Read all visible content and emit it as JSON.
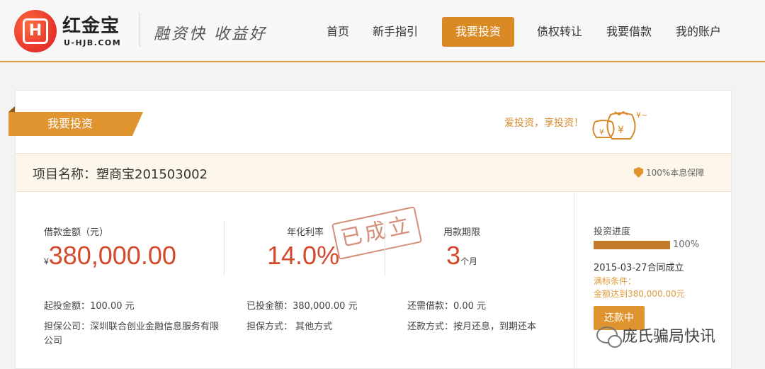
{
  "header": {
    "brand_name": "红金宝",
    "brand_url": "U-HJB.COM",
    "logo_icon": "H",
    "slogan": "融资快 收益好",
    "nav": [
      {
        "label": "首页"
      },
      {
        "label": "新手指引"
      },
      {
        "label": "我要投资",
        "active": true
      },
      {
        "label": "债权转让"
      },
      {
        "label": "我要借款"
      },
      {
        "label": "我的账户"
      }
    ]
  },
  "section": {
    "title": "我要投资",
    "tagline": "爱投资，享投资！",
    "decor_icon": "moneybag-icon",
    "decor_text": "¥~"
  },
  "project": {
    "name": "项目名称：塑商宝201503002",
    "guarantee": "100%本息保障"
  },
  "stats": {
    "amount_label": "借款金额（元）",
    "currency_symbol": "¥",
    "amount_value": "380,000.00",
    "rate_label": "年化利率",
    "rate_value": "14.0%",
    "term_label": "用款期限",
    "term_value": "3",
    "term_unit": "个月",
    "stamp": "已成立"
  },
  "details": {
    "min_invest": "起投金额：100.00 元",
    "invested": "已投金额：380,000.00 元",
    "remaining": "还需借款：0.00 元",
    "guarantor": "担保公司：深圳联合创业金融信息服务有限公司",
    "guarantee_method": "担保方式： 其他方式",
    "repay_method": "还款方式：按月还息，到期还本"
  },
  "progress": {
    "label": "投资进度",
    "percent": 100,
    "percent_text": "100%",
    "date_text": "2015-03-27合同成立",
    "cond_title": "满标条件：",
    "cond_text": "金额达到380,000.00元",
    "button": "还款中"
  },
  "watermark": {
    "icon": "wechat-icon",
    "text": "庞氏骗局快讯"
  },
  "colors": {
    "accent": "#e0942f",
    "number_red": "#d34a2a"
  }
}
